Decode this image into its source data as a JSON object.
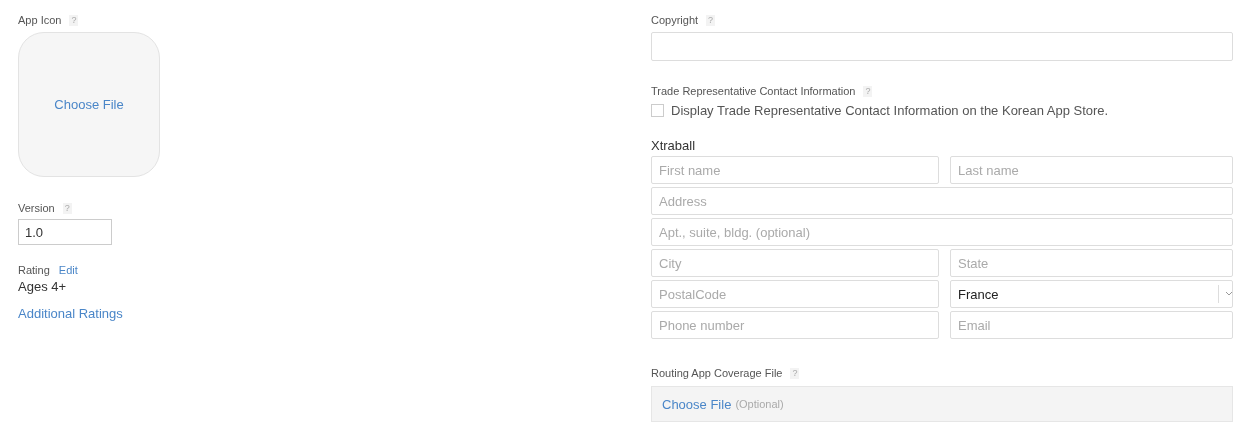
{
  "app_icon": {
    "label": "App Icon",
    "help": "?",
    "button": "Choose File"
  },
  "version": {
    "label": "Version",
    "help": "?",
    "value": "1.0"
  },
  "rating": {
    "label": "Rating",
    "edit": "Edit",
    "value": "Ages 4+",
    "additional": "Additional Ratings"
  },
  "copyright": {
    "label": "Copyright",
    "help": "?"
  },
  "trade_rep": {
    "label": "Trade Representative Contact Information",
    "help": "?",
    "checkbox": {
      "label": "Display Trade Representative Contact Information on the Korean App Store.",
      "checked": false
    }
  },
  "contact": {
    "title": "Xtraball",
    "rows": [
      [
        {
          "kind": "text",
          "placeholder": "First name"
        },
        {
          "kind": "text",
          "placeholder": "Last name"
        }
      ],
      [
        {
          "kind": "text",
          "placeholder": "Address"
        }
      ],
      [
        {
          "kind": "text",
          "placeholder": "Apt., suite, bldg. (optional)"
        }
      ],
      [
        {
          "kind": "text",
          "placeholder": "City"
        },
        {
          "kind": "text",
          "placeholder": "State"
        }
      ],
      [
        {
          "kind": "text",
          "placeholder": "PostalCode"
        },
        {
          "kind": "select",
          "value": "France"
        }
      ],
      [
        {
          "kind": "text",
          "placeholder": "Phone number"
        },
        {
          "kind": "text",
          "placeholder": "Email"
        }
      ]
    ]
  },
  "routing": {
    "label": "Routing App Coverage File",
    "help": "?",
    "button": "Choose File",
    "hint": "(Optional)"
  }
}
